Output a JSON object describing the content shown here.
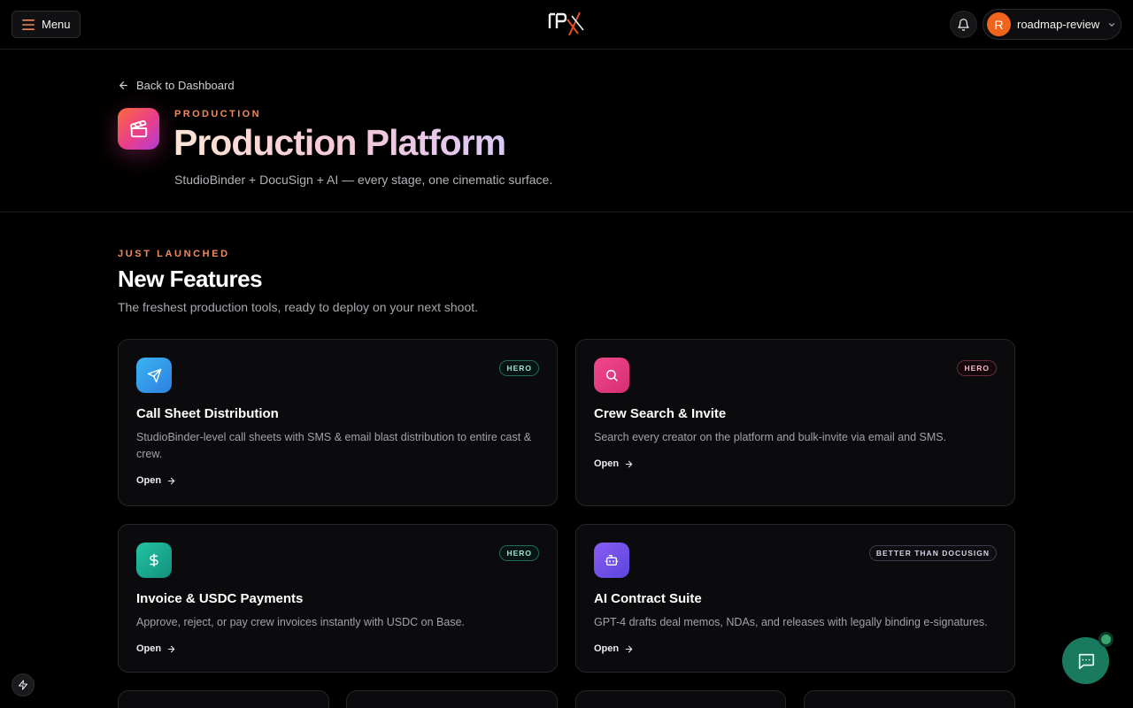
{
  "topbar": {
    "menu_label": "Menu",
    "logo_alt": "IPX",
    "user": {
      "initial": "R",
      "name": "roadmap-review"
    }
  },
  "header": {
    "back_label": "Back to Dashboard",
    "eyebrow": "PRODUCTION",
    "title": "Production Platform",
    "subtitle": "StudioBinder + DocuSign + AI — every stage, one cinematic surface."
  },
  "section": {
    "eyebrow": "JUST LAUNCHED",
    "title": "New Features",
    "subtitle": "The freshest production tools, ready to deploy on your next shoot."
  },
  "cards": [
    {
      "icon": "send-icon",
      "badge": "HERO",
      "title": "Call Sheet Distribution",
      "description": "StudioBinder-level call sheets with SMS & email blast distribution to entire cast & crew.",
      "open_label": "Open"
    },
    {
      "icon": "search-icon",
      "badge": "HERO",
      "title": "Crew Search & Invite",
      "description": "Search every creator on the platform and bulk-invite via email and SMS.",
      "open_label": "Open"
    },
    {
      "icon": "dollar-icon",
      "badge": "HERO",
      "title": "Invoice & USDC Payments",
      "description": "Approve, reject, or pay crew invoices instantly with USDC on Base.",
      "open_label": "Open"
    },
    {
      "icon": "robot-icon",
      "badge": "BETTER THAN DOCUSIGN",
      "title": "AI Contract Suite",
      "description": "GPT-4 drafts deal memos, NDAs, and releases with legally binding e-signatures.",
      "open_label": "Open"
    }
  ],
  "colors": {
    "accent": "#f08a5d",
    "background": "#000000",
    "card_border": "#26262a",
    "chat": "#1a7a5e"
  }
}
